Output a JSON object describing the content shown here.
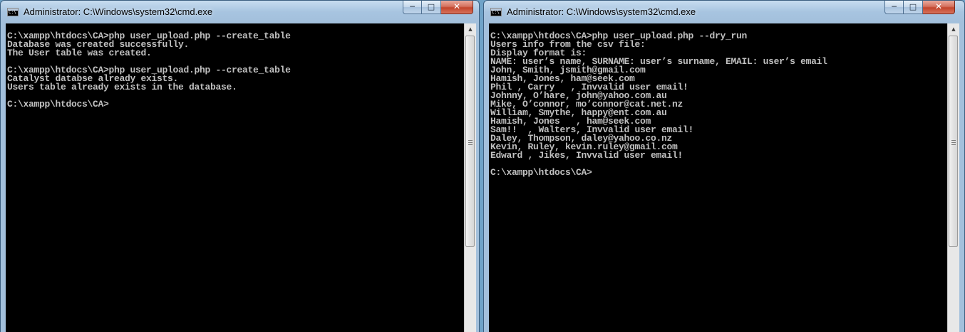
{
  "windows": [
    {
      "title": "Administrator: C:\\Windows\\system32\\cmd.exe",
      "buttons": {
        "minimize": "─",
        "maximize": "□",
        "close": "✕"
      },
      "lines": [
        "C:\\xampp\\htdocs\\CA>php user_upload.php --create_table",
        "Database was created successfully.",
        "The User table was created.",
        "",
        "C:\\xampp\\htdocs\\CA>php user_upload.php --create_table",
        "Catalyst databse already exists.",
        "Users table already exists in the database.",
        "",
        "C:\\xampp\\htdocs\\CA>"
      ]
    },
    {
      "title": "Administrator: C:\\Windows\\system32\\cmd.exe",
      "buttons": {
        "minimize": "─",
        "maximize": "□",
        "close": "✕"
      },
      "lines": [
        "C:\\xampp\\htdocs\\CA>php user_upload.php --dry_run",
        "Users info from the csv file:",
        "Display format is:",
        "NAME: user’s name, SURNAME: user’s surname, EMAIL: user’s email",
        "John, Smith, jsmith@gmail.com",
        "Hamish, Jones, ham@seek.com",
        "Phil , Carry   , Invvalid user email!",
        "Johnny, O’hare, john@yahoo.com.au",
        "Mike, O’connor, mo’connor@cat.net.nz",
        "William, Smythe, happy@ent.com.au",
        "Hamish, Jones   , ham@seek.com",
        "Sam!!  , Walters, Invvalid user email!",
        "Daley, Thompson, daley@yahoo.co.nz",
        "Kevin, Ruley, kevin.ruley@gmail.com",
        "Edward , Jikes, Invvalid user email!",
        "",
        "C:\\xampp\\htdocs\\CA>"
      ]
    }
  ],
  "colors": {
    "console_background": "#000000",
    "console_text": "#c0c0c0",
    "titlebar": "#a7c4e0",
    "close_button": "#c2452c"
  },
  "icons": [
    "cmd-app-icon",
    "minimize-icon",
    "maximize-icon",
    "close-icon",
    "scroll-up-arrow-icon",
    "scroll-grip-icon"
  ]
}
